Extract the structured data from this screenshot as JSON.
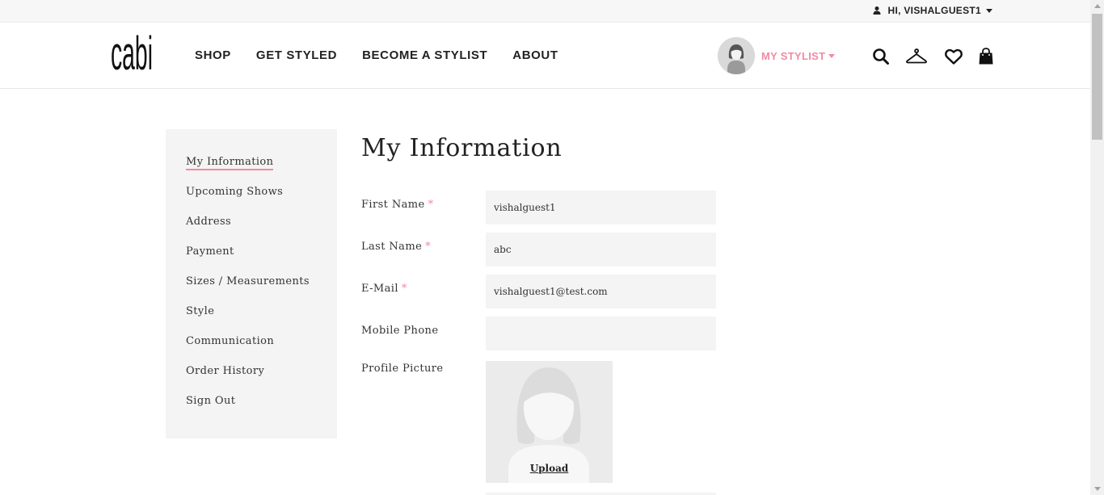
{
  "topbar": {
    "greeting": "HI, VISHALGUEST1"
  },
  "logo": {
    "text": "cabi"
  },
  "nav": [
    "SHOP",
    "GET STYLED",
    "BECOME A STYLIST",
    "ABOUT"
  ],
  "stylist": {
    "label": "MY STYLIST"
  },
  "header_icons": [
    "search-icon",
    "hanger-icon",
    "heart-icon",
    "bag-icon"
  ],
  "sidebar": {
    "items": [
      {
        "label": "My Information",
        "active": true
      },
      {
        "label": "Upcoming Shows"
      },
      {
        "label": "Address"
      },
      {
        "label": "Payment"
      },
      {
        "label": "Sizes / Measurements"
      },
      {
        "label": "Style"
      },
      {
        "label": "Communication"
      },
      {
        "label": "Order History"
      },
      {
        "label": "Sign Out"
      }
    ]
  },
  "form": {
    "title": "My Information",
    "required_mark": "*",
    "first_name": {
      "label": "First Name",
      "value": "vishalguest1"
    },
    "last_name": {
      "label": "Last Name",
      "value": "abc"
    },
    "email": {
      "label": "E-Mail",
      "value": "vishalguest1@test.com"
    },
    "mobile": {
      "label": "Mobile Phone",
      "value": ""
    },
    "profile_picture": {
      "label": "Profile Picture",
      "upload_label": "Upload"
    }
  },
  "colors": {
    "accent_pink": "#f08aa4",
    "field_bg": "#f4f4f4",
    "sidebar_bg": "#f4f4f4"
  }
}
